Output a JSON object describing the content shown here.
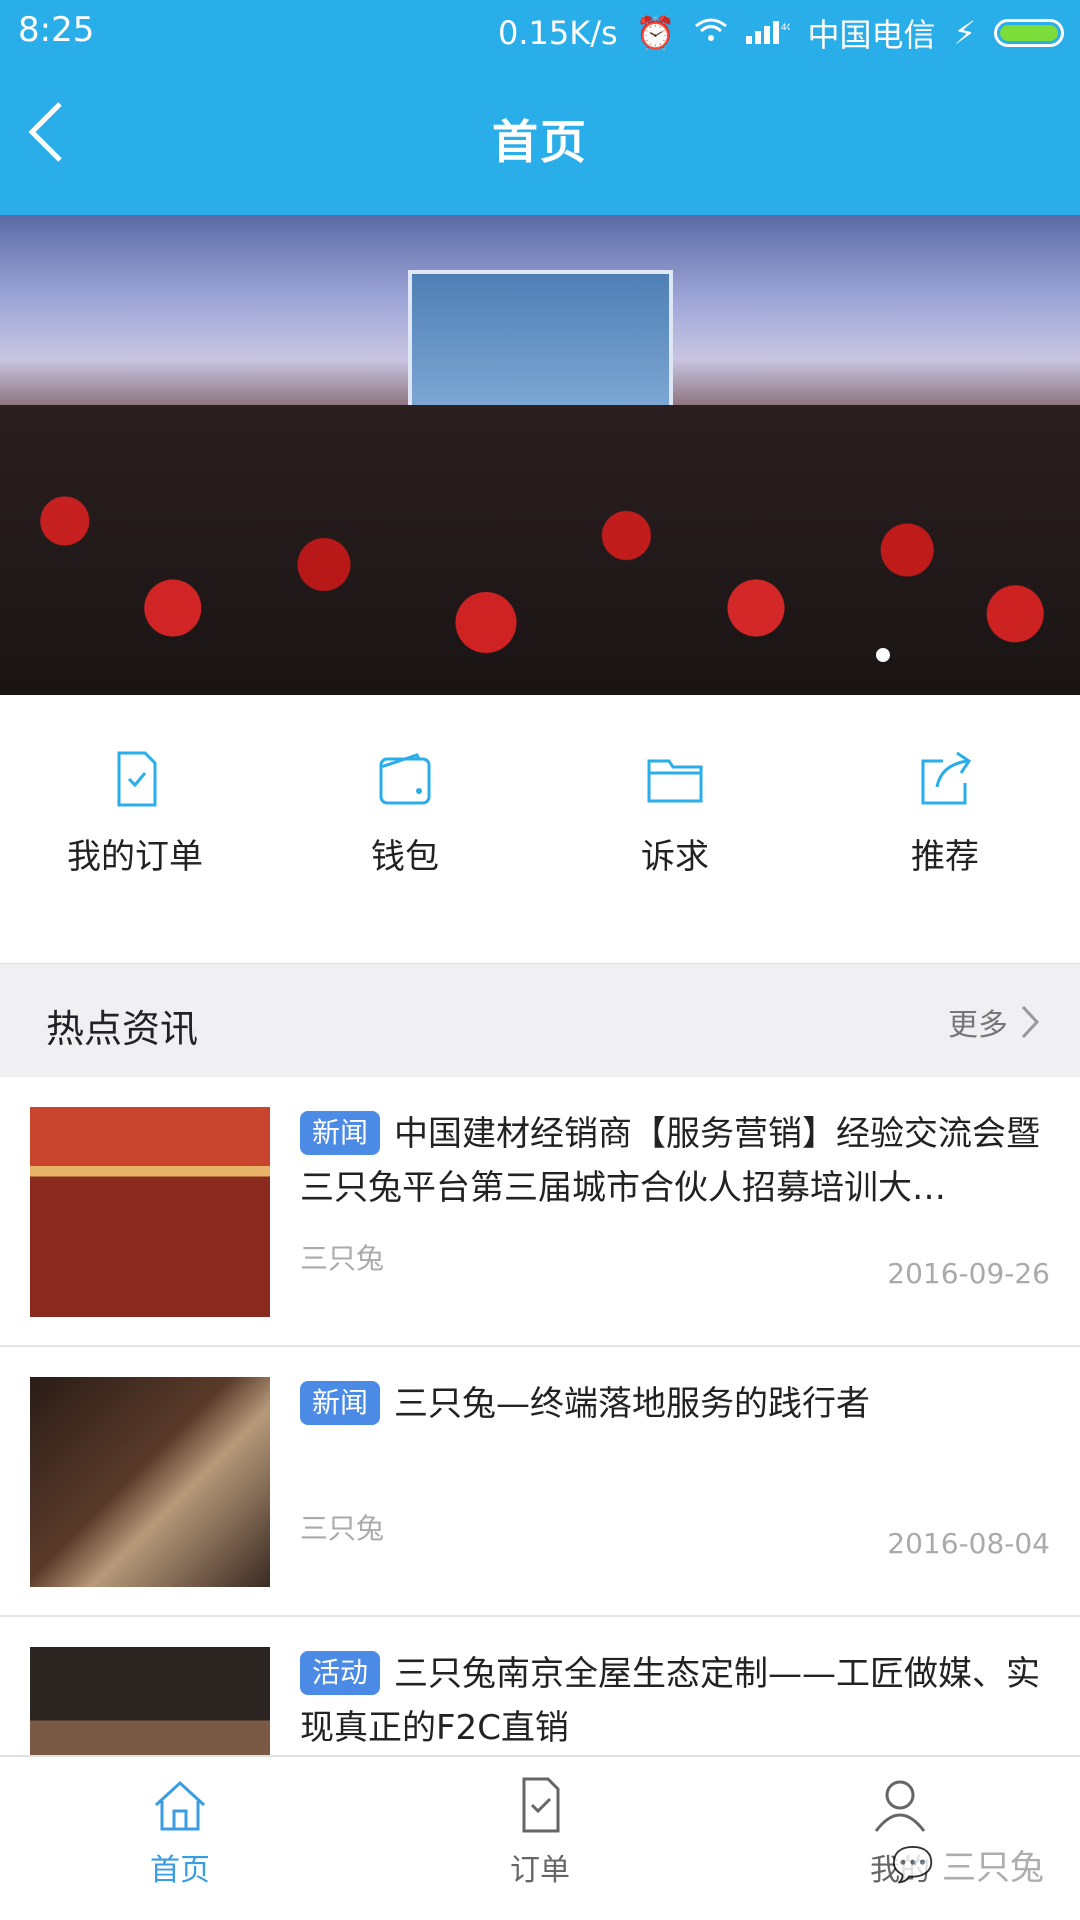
{
  "status_bar": {
    "time": "8:25",
    "speed": "0.15K/s",
    "carrier": "中国电信"
  },
  "header": {
    "title": "首页"
  },
  "quick_nav": [
    {
      "label": "我的订单",
      "icon": "order-doc-icon"
    },
    {
      "label": "钱包",
      "icon": "wallet-icon"
    },
    {
      "label": "诉求",
      "icon": "folder-icon"
    },
    {
      "label": "推荐",
      "icon": "share-icon"
    }
  ],
  "section": {
    "title": "热点资讯",
    "more": "更多"
  },
  "news": [
    {
      "tag": "新闻",
      "title": "中国建材经销商【服务营销】经验交流会暨三只兔平台第三届城市合伙人招募培训大…",
      "source": "三只兔",
      "date": "2016-09-26"
    },
    {
      "tag": "新闻",
      "title": "三只兔—终端落地服务的践行者",
      "source": "三只兔",
      "date": "2016-08-04"
    },
    {
      "tag": "活动",
      "title": "三只兔南京全屋生态定制——工匠做媒、实现真正的F2C直销",
      "source": "",
      "date": ""
    }
  ],
  "tabbar": [
    {
      "label": "首页",
      "active": true
    },
    {
      "label": "订单",
      "active": false
    },
    {
      "label": "我的",
      "active": false
    }
  ],
  "watermark": "三只兔",
  "colors": {
    "primary": "#2aaee9",
    "badge": "#4b8be6",
    "active_tab": "#3a9de3"
  }
}
